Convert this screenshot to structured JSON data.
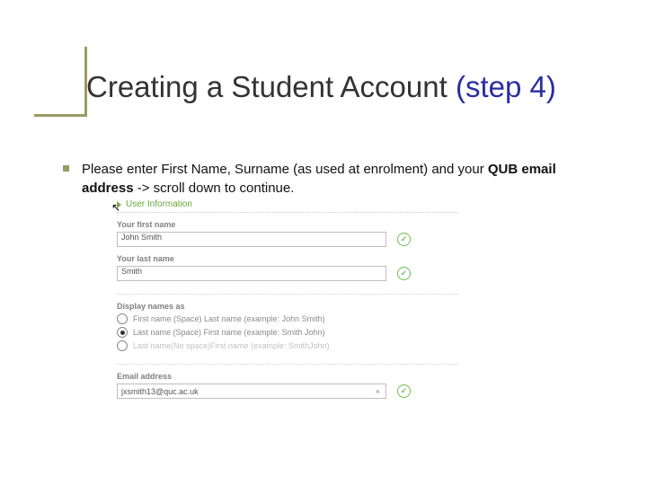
{
  "title": {
    "main": "Creating a Student Account",
    "step": "(step 4)"
  },
  "bullet": {
    "pre": "Please enter First Name, Surname (as used at enrolment) and your ",
    "bold": "QUB email address",
    "post": " -> scroll down to continue."
  },
  "form": {
    "section_title": "User Information",
    "first_name": {
      "label": "Your first name",
      "value": "John Smith"
    },
    "last_name": {
      "label": "Your last name",
      "value": "Smith"
    },
    "display": {
      "label": "Display names as",
      "options": [
        "First name (Space) Last name (example: John Smith)",
        "Last name (Space) First name (example: Smith John)",
        "Last name(No space)First name (example: SmithJohn)"
      ],
      "selected_index": 1
    },
    "email": {
      "label": "Email address",
      "value": "jxsmith13@quc.ac.uk"
    }
  }
}
